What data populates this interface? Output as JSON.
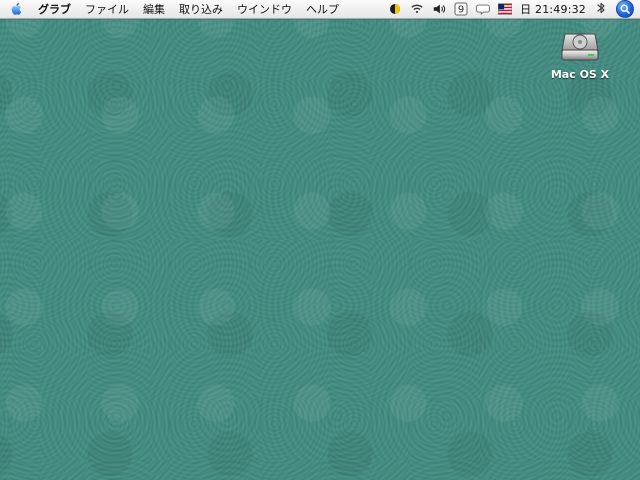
{
  "menubar": {
    "app_menu": "グラブ",
    "items": [
      "ファイル",
      "編集",
      "取り込み",
      "ウインドウ",
      "ヘルプ"
    ],
    "clock": "日 21:49:32",
    "input_badge": "9",
    "status_icons": [
      "half-moon-icon",
      "wifi-icon",
      "volume-icon",
      "keyboard-badge-icon",
      "speech-bubble-icon",
      "us-flag-icon",
      "bluetooth-icon",
      "spotlight-icon"
    ]
  },
  "desktop": {
    "items": [
      {
        "label": "Mac OS X",
        "icon": "hard-drive-icon"
      }
    ]
  },
  "colors": {
    "desktop_background": "#3f8a7f",
    "menubar": "#f3f3f3",
    "spotlight_accent": "#1f5fdc"
  }
}
